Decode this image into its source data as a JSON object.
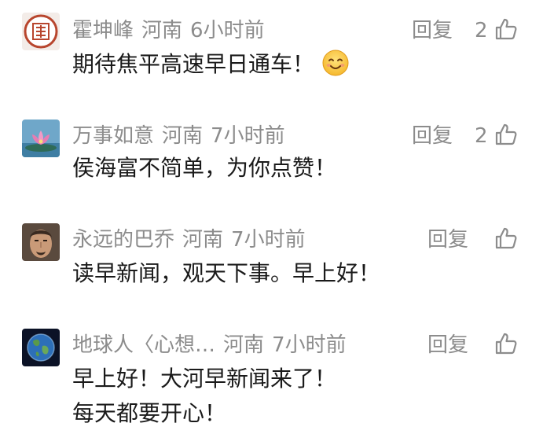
{
  "comments": [
    {
      "username": "霍坤峰",
      "location": "河南",
      "time": "6小时前",
      "reply": "回复",
      "likes": "2",
      "text": "期待焦平高速早日通车！",
      "emoji": "smiling-face-emoji",
      "avatar": "seal-avatar"
    },
    {
      "username": "万事如意",
      "location": "河南",
      "time": "7小时前",
      "reply": "回复",
      "likes": "2",
      "text": "侯海富不简单，为你点赞！",
      "avatar": "lotus-avatar"
    },
    {
      "username": "永远的巴乔",
      "location": "河南",
      "time": "7小时前",
      "reply": "回复",
      "likes": "",
      "text": "读早新闻，观天下事。早上好！",
      "avatar": "portrait-avatar"
    },
    {
      "username": "地球人〈心想…",
      "location": "河南",
      "time": "7小时前",
      "reply": "回复",
      "likes": "",
      "text_line1": "早上好！大河早新闻来了！",
      "text_line2": "每天都要开心！",
      "avatar": "earth-avatar"
    }
  ],
  "icons": {
    "like": "thumbs-up-icon"
  },
  "colors": {
    "meta": "#8c8c8c",
    "text": "#1a1a1a",
    "seal": "#b8462e"
  }
}
